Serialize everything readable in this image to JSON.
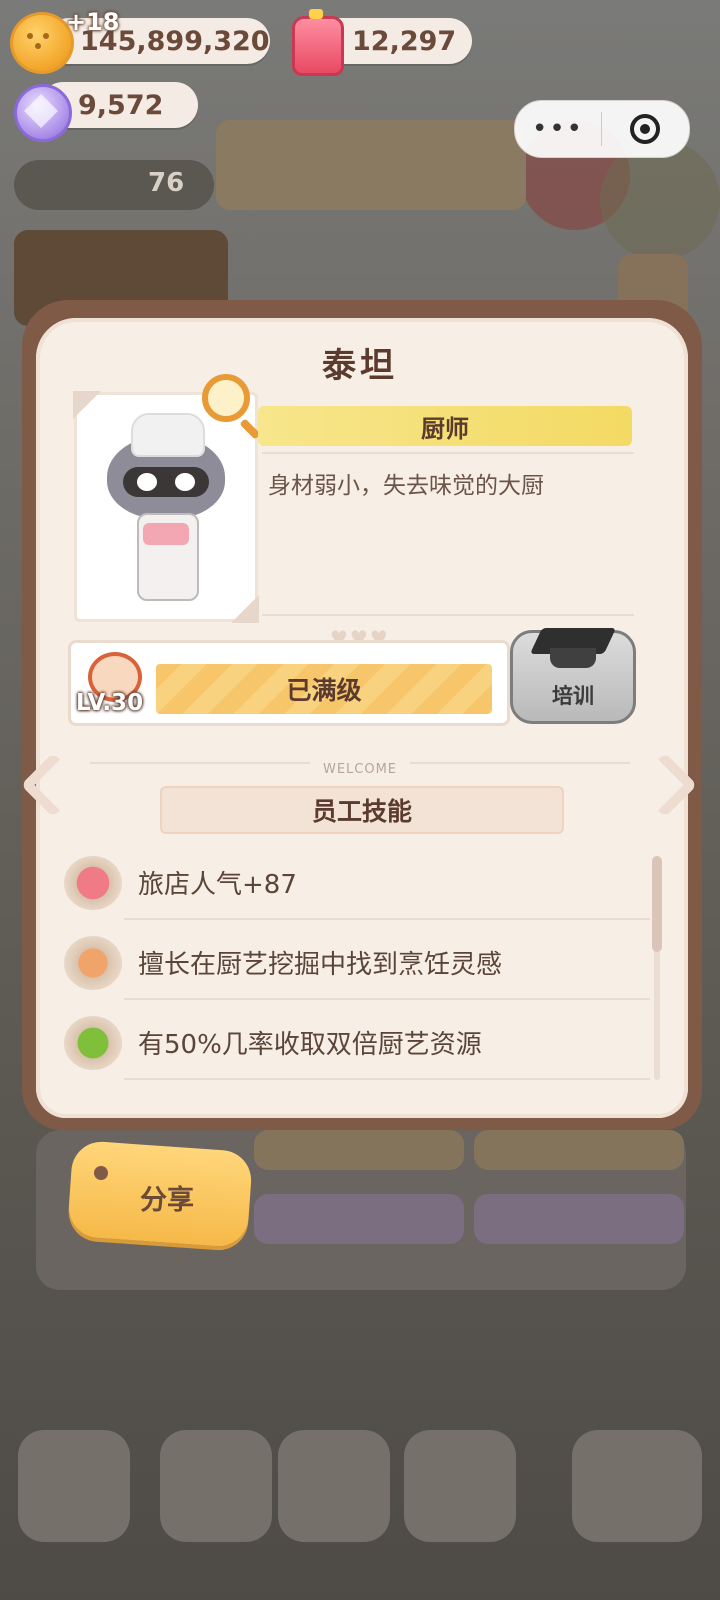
{
  "resources": {
    "coins": "145,899,320",
    "coin_bonus": "+18",
    "jam": "12,297",
    "gems": "9,572",
    "side_counter": "76"
  },
  "mini_program": {
    "menu_icon": "more-dots-icon",
    "close_icon": "target-close-icon"
  },
  "staff": {
    "name": "泰坦",
    "job": "厨师",
    "description": "身材弱小，失去味觉的大厨",
    "level_label": "LV.30",
    "level_status": "已满级",
    "train_label": "培训"
  },
  "skills": {
    "welcome_text": "WELCOME",
    "title": "员工技能",
    "items": [
      {
        "icon": "jam-skill-icon",
        "text": "旅店人气+87"
      },
      {
        "icon": "drumstick-skill-icon",
        "text": "擅长在厨艺挖掘中找到烹饪灵感"
      },
      {
        "icon": "broccoli-skill-icon",
        "text": "有50%几率收取双倍厨艺资源"
      }
    ]
  },
  "share_label": "分享",
  "colors": {
    "accent_yellow": "#f6b949",
    "text_brown": "#5a3b2e",
    "card_bg": "#f7eee6",
    "frame_brown": "#7e5a47"
  }
}
